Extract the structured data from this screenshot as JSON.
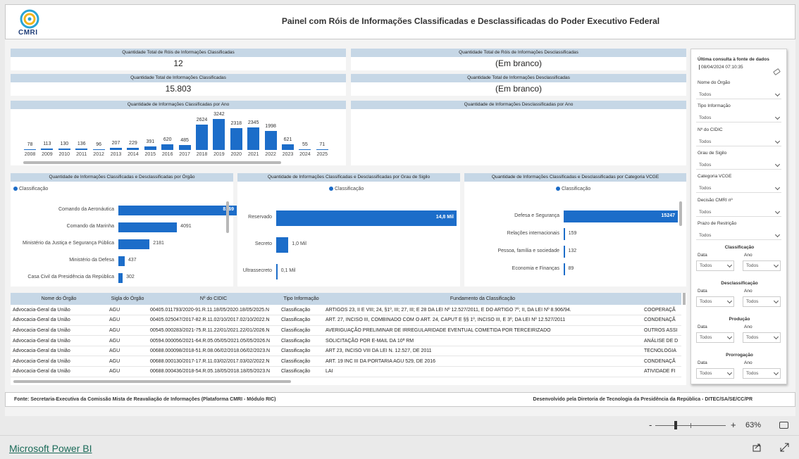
{
  "header": {
    "logo_text": "CMRI",
    "title": "Painel com Róis de Informações Classificadas e Desclassificadas do Poder Executivo Federal"
  },
  "kpis": [
    {
      "label": "Quantidade Total de Róis de Informações Classificadas",
      "value": "12"
    },
    {
      "label": "Quantidade Total de Róis de Informações Desclassificadas",
      "value": "(Em branco)"
    },
    {
      "label": "Quantidade Total de Informações Classificadas",
      "value": "15.803"
    },
    {
      "label": "Quantidade Total de Informações Desclassificadas",
      "value": "(Em branco)"
    }
  ],
  "by_year": {
    "title": "Quantidade de Informações Classificadas por Ano",
    "empty_title": "Quantidade de Informações Desclassificadas por Ano"
  },
  "chart_data": [
    {
      "type": "bar",
      "title": "Quantidade de Informações Classificadas por Ano",
      "categories": [
        "2008",
        "2009",
        "2010",
        "2011",
        "2012",
        "2013",
        "2014",
        "2015",
        "2016",
        "2017",
        "2018",
        "2019",
        "2020",
        "2021",
        "2022",
        "2023",
        "2024",
        "2025"
      ],
      "values": [
        78,
        113,
        130,
        136,
        96,
        207,
        229,
        391,
        620,
        485,
        2624,
        3242,
        2318,
        2345,
        1998,
        621,
        55,
        71
      ]
    },
    {
      "type": "bar",
      "title": "Quantidade de Informações Classificadas e Desclassificadas por Órgão",
      "series": [
        {
          "name": "Classificação",
          "values": [
            8269,
            4091,
            2181,
            437,
            302
          ]
        }
      ],
      "categories": [
        "Comando da Aeronáutica",
        "Comando da Marinha",
        "Ministério da Justiça e Segurança Pública",
        "Ministério da Defesa",
        "Casa Civil da Presidência da República"
      ]
    },
    {
      "type": "bar",
      "title": "Quantidade de Informações Classificadas e Desclassificadas por Grau de Sigilo",
      "series": [
        {
          "name": "Classificação",
          "values": [
            14800,
            1000,
            100
          ]
        }
      ],
      "categories": [
        "Reservado",
        "Secreto",
        "Ultrassecreto"
      ],
      "value_labels": [
        "14,8 Mil",
        "1,0 Mil",
        "0,1 Mil"
      ]
    },
    {
      "type": "bar",
      "title": "Quantidade de Informações Classificadas e Desclassificadas por Categoria VCGE",
      "series": [
        {
          "name": "Classificação",
          "values": [
            15247,
            159,
            132,
            89
          ]
        }
      ],
      "categories": [
        "Defesa e Segurança",
        "Relações internacionais",
        "Pessoa, família e sociedade",
        "Economia e Finanças"
      ]
    }
  ],
  "legend_label": "Classificação",
  "table": {
    "headers": [
      "Nome do Órgão",
      "Sigla do Órgão",
      "Nº do CIDIC",
      "Tipo Informação",
      "Fundamento da Classificação",
      ""
    ],
    "rows": [
      [
        "Advocacia-Geral da União",
        "AGU",
        "00405.011793/2020-91.R.11.18/05/2020.18/05/2025.N",
        "Classificação",
        "ARTIGOS 23, II E VIII; 24, §1º, III; 27, III; E 28 DA LEI Nº 12.527/2011, E DO ARTIGO 7º, II, DA LEI Nº 8.906/94.",
        "COOPERAÇÃ"
      ],
      [
        "Advocacia-Geral da União",
        "AGU",
        "00405.025047/2017-82.R.11.02/10/2017.02/10/2022.N",
        "Classificação",
        "ART. 27, INCISO III, COMBINADO COM O ART. 24, CAPUT E §§ 1º, INCISO III, E 3º, DA LEI Nº 12.527/2011",
        "CONDENAÇÃ"
      ],
      [
        "Advocacia-Geral da União",
        "AGU",
        "00545.000283/2021-75.R.11.22/01/2021.22/01/2026.N",
        "Classificação",
        "AVERIGUAÇÃO PRELIMINAR DE IRREGULARIDADE EVENTUAL COMETIDA POR TERCEIRIZADO",
        "OUTROS ASSI"
      ],
      [
        "Advocacia-Geral da União",
        "AGU",
        "00594.000056/2021-64.R.05.05/05/2021.05/05/2026.N",
        "Classificação",
        "SOLICITAÇÃO POR E-MAIL DA 10ª RM",
        "ANÁLISE DE D"
      ],
      [
        "Advocacia-Geral da União",
        "AGU",
        "00688.000098/2018-51.R.08.06/02/2018.06/02/2023.N",
        "Classificação",
        "ART 23, INCISO VIII DA LEI N. 12.527, DE 2011",
        "TECNOLOGIA"
      ],
      [
        "Advocacia-Geral da União",
        "AGU",
        "00688.000130/2017-17.R.11.03/02/2017.03/02/2022.N",
        "Classificação",
        "ART. 19 INC III DA PORTARIA AGU 529, DE 2016",
        "CONDENAÇÃ"
      ],
      [
        "Advocacia-Geral da União",
        "AGU",
        "00688.000436/2018-54.R.05.18/05/2018.18/05/2023.N",
        "Classificação",
        "LAI",
        "ATIVIDADE FI"
      ]
    ]
  },
  "filters": {
    "last_query_label": "Última consulta à fonte de dados",
    "last_query_value": "08/04/2024 07:10:35",
    "fields": [
      {
        "label": "Nome do Órgão",
        "value": "Todos"
      },
      {
        "label": "Tipo Informação",
        "value": "Todos"
      },
      {
        "label": "Nº do CIDIC",
        "value": "Todos"
      },
      {
        "label": "Grau de Sigilo",
        "value": "Todos"
      },
      {
        "label": "Categoria VCGE",
        "value": "Todos"
      },
      {
        "label": "Decisão CMRI nº",
        "value": "Todos"
      },
      {
        "label": "Prazo de Restrição",
        "value": "Todos"
      }
    ],
    "sections": [
      {
        "title": "Classificação",
        "data_label": "Data",
        "ano_label": "Ano",
        "data_value": "Todos",
        "ano_value": "Todos"
      },
      {
        "title": "Desclassificação",
        "data_label": "Data",
        "ano_label": "Ano",
        "data_value": "Todos",
        "ano_value": "Todos"
      },
      {
        "title": "Produção",
        "data_label": "Data",
        "ano_label": "Ano",
        "data_value": "Todos",
        "ano_value": "Todos"
      },
      {
        "title": "Prorrogação",
        "data_label": "Data",
        "ano_label": "Ano",
        "data_value": "Todos",
        "ano_value": "Todos"
      }
    ]
  },
  "footer": {
    "source": "Fonte: Secretaria-Executiva da Comissão Mista de Reavaliação de Informações (Plataforma CMRI - Módulo RIC)",
    "developer": "Desenvolvido pela Diretoria de Tecnologia da Presidência da República - DITEC/SA/SE/CC/PR"
  },
  "zoom": {
    "minus": "-",
    "plus": "+",
    "value": "63%"
  },
  "bottom": {
    "link": "Microsoft Power BI"
  },
  "colors": {
    "bar": "#1c6dc9",
    "header_band": "#c6d7e6",
    "link": "#1b6b59"
  }
}
